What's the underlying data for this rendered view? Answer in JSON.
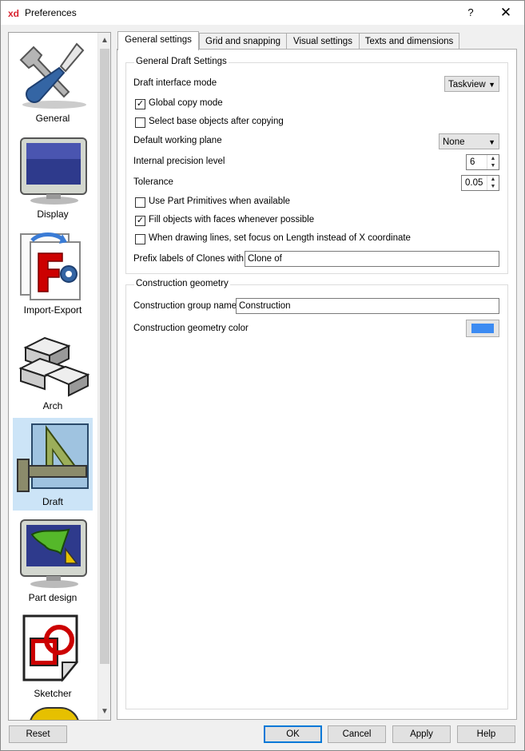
{
  "window": {
    "title": "Preferences",
    "app_icon": "xd",
    "help_label": "?",
    "close_label": "✕"
  },
  "sidebar": {
    "items": [
      {
        "label": "General",
        "icon": "tools-icon"
      },
      {
        "label": "Display",
        "icon": "monitor-icon"
      },
      {
        "label": "Import-Export",
        "icon": "import-export-icon"
      },
      {
        "label": "Arch",
        "icon": "bricks-icon"
      },
      {
        "label": "Draft",
        "icon": "draft-square-icon",
        "selected": true
      },
      {
        "label": "Part design",
        "icon": "part-design-icon"
      },
      {
        "label": "Sketcher",
        "icon": "sketcher-icon"
      }
    ]
  },
  "tabs": [
    "General settings",
    "Grid and snapping",
    "Visual settings",
    "Texts and dimensions"
  ],
  "general": {
    "group_title": "General Draft Settings",
    "interface_mode_label": "Draft interface mode",
    "interface_mode_value": "Taskview",
    "global_copy_label": "Global copy mode",
    "global_copy_checked": true,
    "select_base_label": "Select base objects after copying",
    "select_base_checked": false,
    "working_plane_label": "Default working plane",
    "working_plane_value": "None",
    "precision_label": "Internal precision level",
    "precision_value": "6",
    "tolerance_label": "Tolerance",
    "tolerance_value": "0.05",
    "part_primitives_label": "Use Part Primitives when available",
    "part_primitives_checked": false,
    "fill_faces_label": "Fill objects with faces whenever possible",
    "fill_faces_checked": true,
    "focus_length_label": "When drawing lines, set focus on Length instead of X coordinate",
    "focus_length_checked": false,
    "prefix_clones_label": "Prefix labels of Clones with:",
    "prefix_clones_value": "Clone of"
  },
  "construction": {
    "group_title": "Construction geometry",
    "group_name_label": "Construction group name",
    "group_name_value": "Construction",
    "color_label": "Construction geometry color",
    "color_value": "#3c8bf2"
  },
  "buttons": {
    "reset": "Reset",
    "ok": "OK",
    "cancel": "Cancel",
    "apply": "Apply",
    "help": "Help"
  }
}
